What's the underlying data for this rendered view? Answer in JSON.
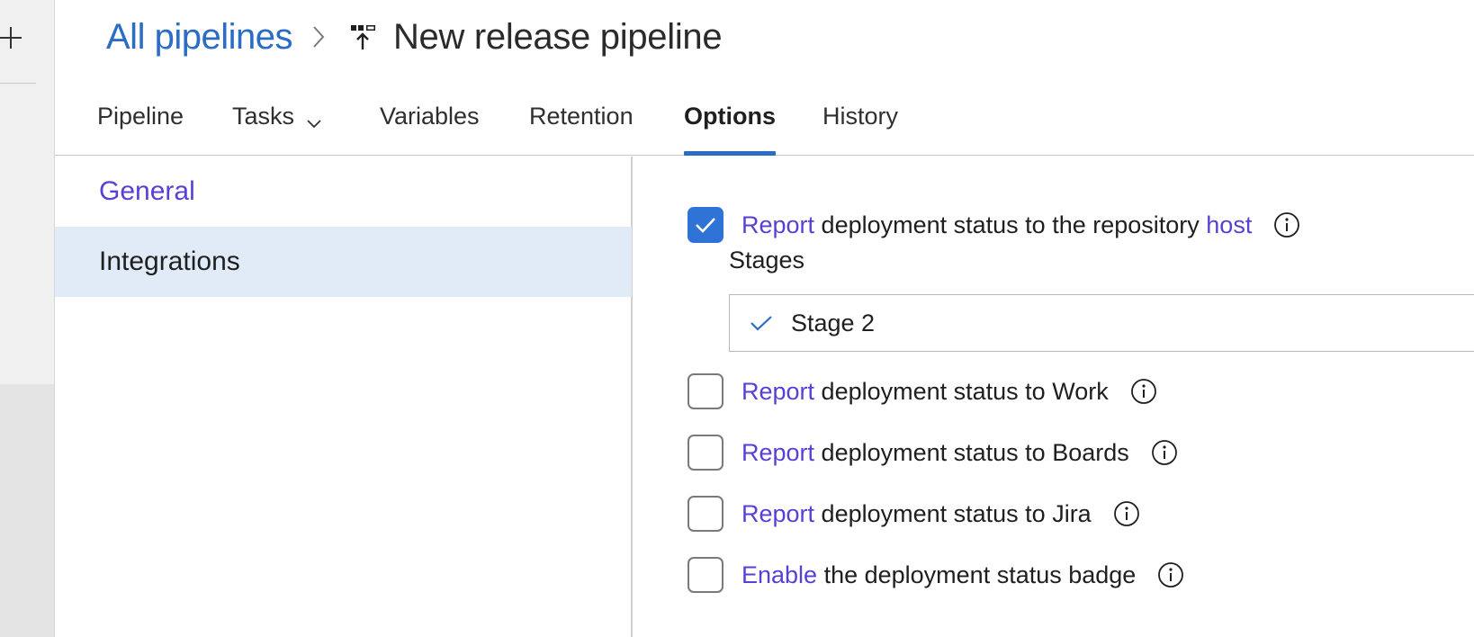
{
  "left_rail": {
    "add_icon": "plus-icon"
  },
  "breadcrumb": {
    "parent": "All pipelines",
    "separator_icon": "chevron-right-icon",
    "pipeline_icon": "release-pipeline-icon",
    "title": "New release pipeline"
  },
  "tabs": [
    {
      "label": "Pipeline",
      "active": false
    },
    {
      "label": "Tasks",
      "active": false,
      "has_dropdown": true
    },
    {
      "label": "Variables",
      "active": false
    },
    {
      "label": "Retention",
      "active": false
    },
    {
      "label": "Options",
      "active": true
    },
    {
      "label": "History",
      "active": false
    }
  ],
  "sidebar": {
    "items": [
      {
        "label": "General",
        "selected": false
      },
      {
        "label": "Integrations",
        "selected": true
      }
    ]
  },
  "options": {
    "repo_host": {
      "checked": true,
      "link": "Report",
      "text": " deployment status to the repository ",
      "link2": "host"
    },
    "stages_label": "Stages",
    "stage_selected": "Stage 2",
    "work": {
      "checked": false,
      "link": "Report",
      "text": " deployment status to Work"
    },
    "boards": {
      "checked": false,
      "link": "Report",
      "text": " deployment status to Boards"
    },
    "jira": {
      "checked": false,
      "link": "Report",
      "text": " deployment status to Jira"
    },
    "badge": {
      "checked": false,
      "link": "Enable",
      "text": " the deployment status badge"
    }
  },
  "colors": {
    "accent_blue": "#2b6cc4",
    "checkbox_blue": "#2f73d6",
    "link_purple": "#5a3fd4",
    "selected_bg": "#e1ebf8"
  }
}
